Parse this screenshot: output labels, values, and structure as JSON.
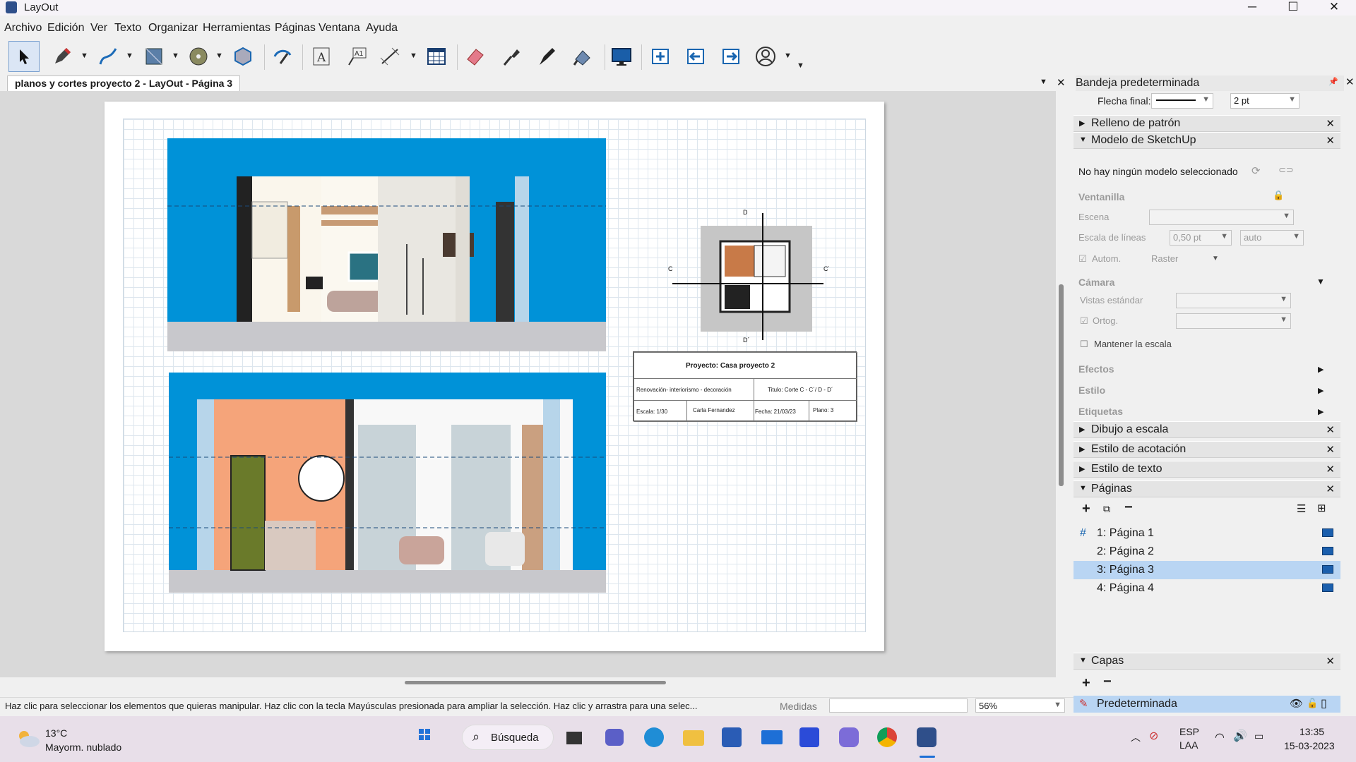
{
  "window": {
    "title": "LayOut",
    "minimize": "─",
    "maximize": "☐",
    "close": "✕"
  },
  "menu": [
    "Archivo",
    "Edición",
    "Ver",
    "Texto",
    "Organizar",
    "Herramientas",
    "Páginas",
    "Ventana",
    "Ayuda"
  ],
  "doc_tab": {
    "label": "planos y cortes proyecto 2 - LayOut - Página 3",
    "close": "✕",
    "dropdown": "▼"
  },
  "title_block": {
    "project": "Proyecto: Casa proyecto 2",
    "type": "Renovación- interiorismo - decoración",
    "title": "Titulo: Corte C - C´/ D - D´",
    "scale": "Escala: 1/30",
    "author": "Carla Fernandez",
    "date": "Fecha: 21/03/23",
    "sheet": "Plano: 3"
  },
  "plan_marks": {
    "d_top": "D",
    "d_bottom": "D´",
    "c_left": "C",
    "c_right": "C´"
  },
  "status": {
    "hint": "Haz clic para seleccionar los elementos que quieras manipular. Haz clic con la tecla Mayúsculas presionada para ampliar la selección. Haz clic y arrastra para una selec...",
    "measures_label": "Medidas",
    "zoom": "56%"
  },
  "panel": {
    "title": "Bandeja predeterminada",
    "arrow_label": "Flecha final:",
    "arrow_size": "2 pt",
    "sections": {
      "pattern": "Relleno de patrón",
      "sketchup": "Modelo de SketchUp",
      "scaled": "Dibujo a escala",
      "dim_style": "Estilo de acotación",
      "text_style": "Estilo de texto",
      "pages": "Páginas",
      "layers": "Capas"
    },
    "sketchup": {
      "no_model": "No hay ningún modelo seleccionado",
      "viewport": "Ventanilla",
      "scene": "Escena",
      "line_scale": "Escala de líneas",
      "line_scale_val": "0,50 pt",
      "line_scale_auto": "auto",
      "autom": "Autom.",
      "raster": "Raster",
      "camera": "Cámara",
      "std_views": "Vistas estándar",
      "ortho": "Ortog.",
      "keep_scale": "Mantener la escala",
      "effects": "Efectos",
      "style": "Estilo",
      "tags": "Etiquetas"
    },
    "pages": [
      {
        "label": "1: Página 1",
        "selected": false
      },
      {
        "label": "2: Página 2",
        "selected": false
      },
      {
        "label": "3: Página 3",
        "selected": true
      },
      {
        "label": "4: Página 4",
        "selected": false
      }
    ],
    "layer": "Predeterminada"
  },
  "taskbar": {
    "temp": "13°C",
    "weather": "Mayorm. nublado",
    "search": "Búsqueda",
    "lang1": "ESP",
    "lang2": "LAA",
    "time": "13:35",
    "date": "15-03-2023"
  },
  "colors": {
    "accent": "#b9d5f3",
    "sky": "#0092d8",
    "floor": "#c8c8cc"
  }
}
